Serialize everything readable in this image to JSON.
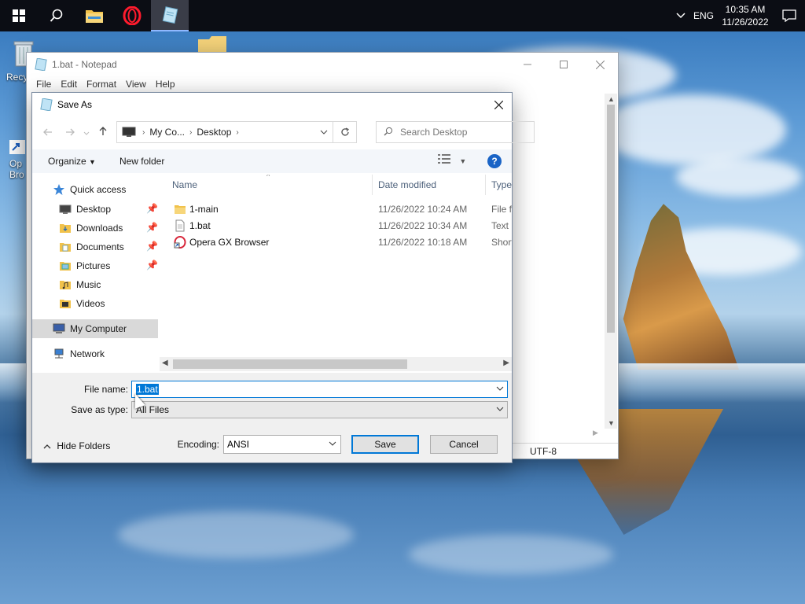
{
  "taskbar": {
    "lang": "ENG",
    "time": "10:35 AM",
    "date": "11/26/2022"
  },
  "desktop": {
    "recycle_label": "Recy",
    "opera_label_1": "Op",
    "opera_label_2": "Bro"
  },
  "notepad": {
    "title": "1.bat - Notepad",
    "menu": [
      "File",
      "Edit",
      "Format",
      "View",
      "Help"
    ],
    "status_encoding": "UTF-8"
  },
  "dialog": {
    "title": "Save As",
    "address": {
      "crumb1": "My Co...",
      "crumb2": "Desktop"
    },
    "search_placeholder": "Search Desktop",
    "toolbar": {
      "organize": "Organize",
      "new_folder": "New folder"
    },
    "nav": [
      {
        "label": "Quick access",
        "level": 0,
        "icon": "star-icon"
      },
      {
        "label": "Desktop",
        "level": 1,
        "icon": "desktop-icon",
        "pinned": true
      },
      {
        "label": "Downloads",
        "level": 1,
        "icon": "downloads-folder-icon",
        "pinned": true
      },
      {
        "label": "Documents",
        "level": 1,
        "icon": "documents-folder-icon",
        "pinned": true
      },
      {
        "label": "Pictures",
        "level": 1,
        "icon": "pictures-folder-icon",
        "pinned": true
      },
      {
        "label": "Music",
        "level": 1,
        "icon": "music-folder-icon",
        "pinned": false
      },
      {
        "label": "Videos",
        "level": 1,
        "icon": "videos-folder-icon",
        "pinned": false
      },
      {
        "label": "My Computer",
        "level": 0,
        "icon": "computer-icon",
        "selected": true
      },
      {
        "label": "Network",
        "level": 0,
        "icon": "network-icon"
      }
    ],
    "columns": {
      "name": "Name",
      "date": "Date modified",
      "type": "Type"
    },
    "files": [
      {
        "name": "1-main",
        "date": "11/26/2022 10:24 AM",
        "type": "File fo",
        "icon": "folder-icon"
      },
      {
        "name": "1.bat",
        "date": "11/26/2022 10:34 AM",
        "type": "Text D",
        "icon": "text-file-icon"
      },
      {
        "name": "Opera GX Browser",
        "date": "11/26/2022 10:18 AM",
        "type": "Short",
        "icon": "shortcut-icon"
      }
    ],
    "form": {
      "filename_label": "File name:",
      "filename_value": "1.bat",
      "savetype_label": "Save as type:",
      "savetype_value": "All Files",
      "hide_folders": "Hide Folders",
      "encoding_label": "Encoding:",
      "encoding_value": "ANSI",
      "save": "Save",
      "cancel": "Cancel"
    }
  },
  "colors": {
    "accent": "#0078d7",
    "taskbar": "#0b0d14"
  }
}
